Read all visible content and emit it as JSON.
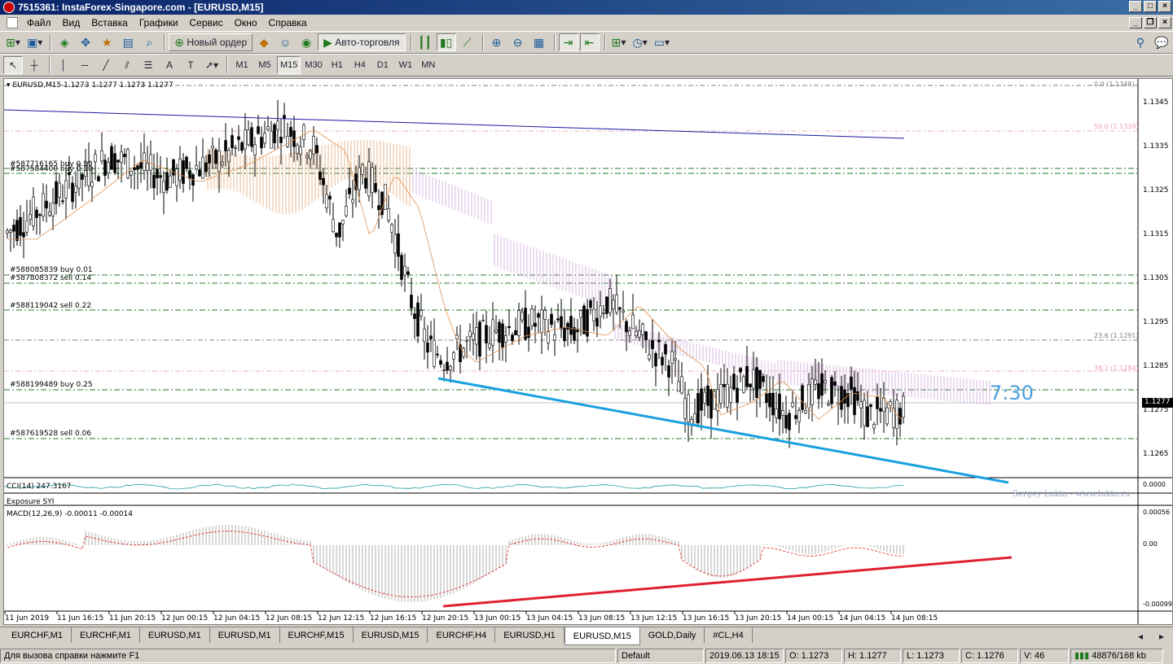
{
  "window": {
    "title": "7515361: InstaForex-Singapore.com - [EURUSD,M15]"
  },
  "menu": [
    "Файл",
    "Вид",
    "Вставка",
    "Графики",
    "Сервис",
    "Окно",
    "Справка"
  ],
  "toolbar1": {
    "new_order_label": "Новый ордер",
    "autotrade_label": "Авто-торговля"
  },
  "toolbar2": {
    "timeframes": [
      "M1",
      "M5",
      "M15",
      "M30",
      "H1",
      "H4",
      "D1",
      "W1",
      "MN"
    ],
    "active_timeframe": "M15"
  },
  "chart": {
    "header": "EURUSD,M15  1.1273 1.1277 1.1273 1.1277",
    "current_price": "1.1277",
    "price_ticks": [
      "1.1345",
      "1.1335",
      "1.1325",
      "1.1315",
      "1.1305",
      "1.1295",
      "1.1285",
      "1.1275",
      "1.1265"
    ],
    "fib_levels": [
      {
        "label": "0.0 (1.1348)",
        "color": "#808080"
      },
      {
        "label": "50.0 (1.1339)",
        "color": "#f0a0b0"
      },
      {
        "label": "23.6 (1.1291)",
        "color": "#808080"
      },
      {
        "label": "38.2 (1.1284)",
        "color": "#f0a0b0"
      }
    ],
    "orders": [
      "#587716165 buy 0.10",
      "#587584400 buy 0.10",
      "#588085839 buy 0.01",
      "#587808372 sell 0.14",
      "#588119042 sell 0.22",
      "#588199489 buy 0.25",
      "#587619528 sell 0.06"
    ],
    "clock_text": "7:30",
    "watermark": "Sergey Lukin - www.lukin.ru",
    "time_labels": [
      "11 Jun 2019",
      "11 Jun 16:15",
      "11 Jun 20:15",
      "12 Jun 00:15",
      "12 Jun 04:15",
      "12 Jun 08:15",
      "12 Jun 12:15",
      "12 Jun 16:15",
      "12 Jun 20:15",
      "13 Jun 00:15",
      "13 Jun 04:15",
      "13 Jun 08:15",
      "13 Jun 12:15",
      "13 Jun 16:15",
      "13 Jun 20:15",
      "14 Jun 00:15",
      "14 Jun 04:15",
      "14 Jun 08:15"
    ]
  },
  "cci": {
    "label": "CCI(14) 247.3167",
    "value_label": "0.0000"
  },
  "exposure": {
    "label": "Exposure SYI"
  },
  "macd": {
    "label": "MACD(12,26,9) -0.00011 -0.00014",
    "ticks": [
      "0.00056",
      "0.00",
      "-0.00099"
    ]
  },
  "tabs": [
    "EURCHF,M1",
    "EURCHF,M1",
    "EURUSD,M1",
    "EURUSD,M1",
    "EURCHF,M15",
    "EURUSD,M15",
    "EURCHF,H4",
    "EURUSD,H1",
    "EURUSD,M15",
    "GOLD,Daily",
    "#CL,H4"
  ],
  "active_tab": 8,
  "status": {
    "help": "Для вызова справки нажмите F1",
    "profile": "Default",
    "datetime": "2019.06.13 18:15",
    "open": "O: 1.1273",
    "high": "H: 1.1277",
    "low": "L: 1.1273",
    "close": "C: 1.1276",
    "volume": "V: 46",
    "traffic": "48876/168 kb"
  }
}
